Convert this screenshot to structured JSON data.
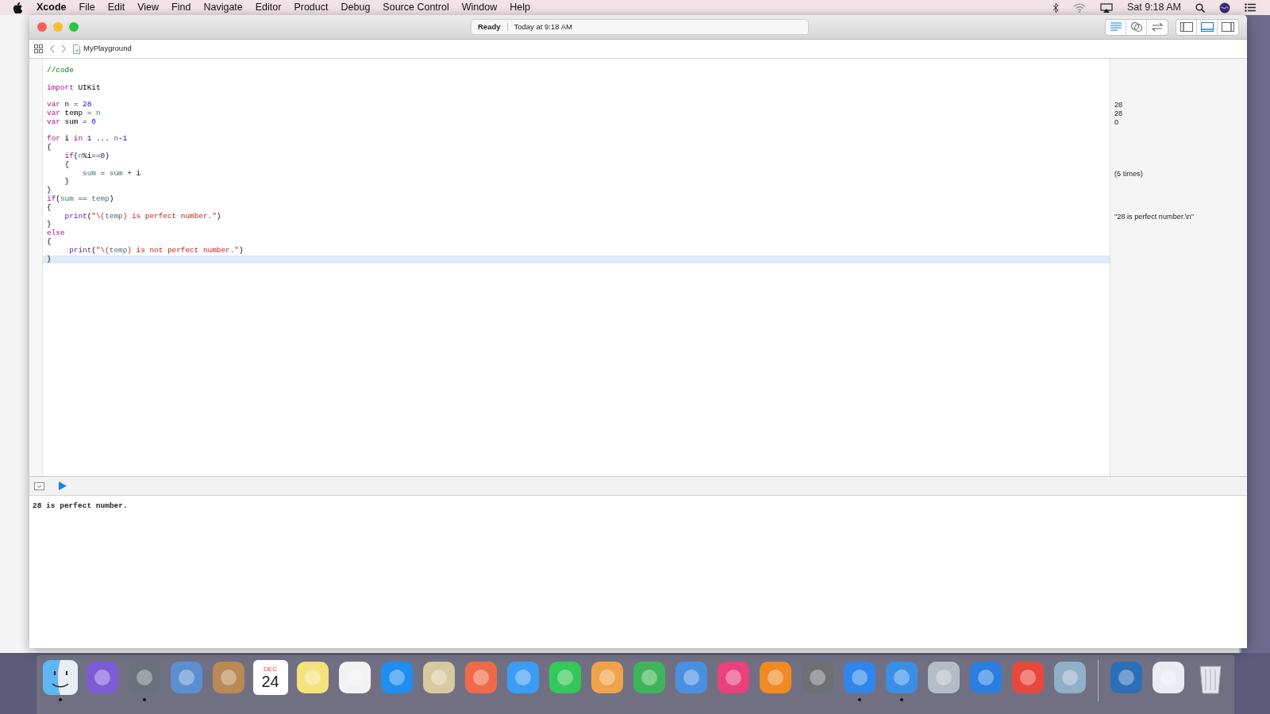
{
  "menu_bar": {
    "app_name": "Xcode",
    "menus": [
      "File",
      "Edit",
      "View",
      "Find",
      "Navigate",
      "Editor",
      "Product",
      "Debug",
      "Source Control",
      "Window",
      "Help"
    ],
    "clock": "Sat 9:18 AM"
  },
  "window": {
    "activity": {
      "status": "Ready",
      "time": "Today at 9:18 AM"
    },
    "editor_modes": [
      {
        "kind": "standard",
        "selected": true
      },
      {
        "kind": "assistant",
        "selected": false
      },
      {
        "kind": "version",
        "selected": false
      }
    ],
    "panels": [
      {
        "kind": "navigator",
        "selected": false
      },
      {
        "kind": "debug",
        "selected": true
      },
      {
        "kind": "utilities",
        "selected": false
      }
    ],
    "file_name": "MyPlayground"
  },
  "code_lines": [
    {
      "kind": "code",
      "current": false,
      "tokens": [
        {
          "text": "//code",
          "kind": "comment"
        }
      ]
    },
    {
      "kind": "blank"
    },
    {
      "kind": "code",
      "current": false,
      "tokens": [
        {
          "text": "import",
          "kind": "keyword"
        },
        {
          "text": " UIKit",
          "kind": "plain"
        }
      ]
    },
    {
      "kind": "blank"
    },
    {
      "kind": "code",
      "current": false,
      "result": "28",
      "tokens": [
        {
          "text": "var",
          "kind": "keyword"
        },
        {
          "text": " n = ",
          "kind": "plain"
        },
        {
          "text": "28",
          "kind": "number"
        }
      ]
    },
    {
      "kind": "code",
      "current": false,
      "result": "28",
      "tokens": [
        {
          "text": "var",
          "kind": "keyword"
        },
        {
          "text": " temp = ",
          "kind": "plain"
        },
        {
          "text": "n",
          "kind": "ident"
        }
      ]
    },
    {
      "kind": "code",
      "current": false,
      "result": "0",
      "tokens": [
        {
          "text": "var",
          "kind": "keyword"
        },
        {
          "text": " sum = ",
          "kind": "plain"
        },
        {
          "text": "0",
          "kind": "number"
        }
      ]
    },
    {
      "kind": "blank"
    },
    {
      "kind": "code",
      "current": false,
      "tokens": [
        {
          "text": "for",
          "kind": "keyword"
        },
        {
          "text": " i ",
          "kind": "plain"
        },
        {
          "text": "in",
          "kind": "keyword"
        },
        {
          "text": " 1",
          "kind": "number"
        },
        {
          "text": " ... ",
          "kind": "plain"
        },
        {
          "text": "n",
          "kind": "ident"
        },
        {
          "text": "-",
          "kind": "plain"
        },
        {
          "text": "1",
          "kind": "number"
        }
      ]
    },
    {
      "kind": "code",
      "current": false,
      "tokens": [
        {
          "text": "{",
          "kind": "plain"
        }
      ]
    },
    {
      "kind": "code",
      "current": false,
      "tokens": [
        {
          "text": "    if",
          "kind": "keyword"
        },
        {
          "text": "(",
          "kind": "plain"
        },
        {
          "text": "n",
          "kind": "ident"
        },
        {
          "text": "%i==",
          "kind": "plain"
        },
        {
          "text": "0",
          "kind": "number"
        },
        {
          "text": ")",
          "kind": "plain"
        }
      ]
    },
    {
      "kind": "code",
      "current": false,
      "tokens": [
        {
          "text": "    {",
          "kind": "plain"
        }
      ]
    },
    {
      "kind": "code",
      "current": false,
      "result": "(5 times)",
      "tokens": [
        {
          "text": "        sum",
          "kind": "ident"
        },
        {
          "text": " = ",
          "kind": "plain"
        },
        {
          "text": "sum",
          "kind": "ident"
        },
        {
          "text": " + i",
          "kind": "plain"
        }
      ]
    },
    {
      "kind": "code",
      "current": false,
      "tokens": [
        {
          "text": "    }",
          "kind": "plain"
        }
      ]
    },
    {
      "kind": "code",
      "current": false,
      "tokens": [
        {
          "text": "}",
          "kind": "plain"
        }
      ]
    },
    {
      "kind": "code",
      "current": false,
      "tokens": [
        {
          "text": "if",
          "kind": "keyword"
        },
        {
          "text": "(",
          "kind": "plain"
        },
        {
          "text": "sum",
          "kind": "ident"
        },
        {
          "text": " == ",
          "kind": "plain"
        },
        {
          "text": "temp",
          "kind": "ident"
        },
        {
          "text": ")",
          "kind": "plain"
        }
      ]
    },
    {
      "kind": "code",
      "current": false,
      "tokens": [
        {
          "text": "{",
          "kind": "plain"
        }
      ]
    },
    {
      "kind": "code",
      "current": false,
      "result": "\"28 is perfect number.\\n\"",
      "tokens": [
        {
          "text": "    print",
          "kind": "func"
        },
        {
          "text": "(",
          "kind": "plain"
        },
        {
          "text": "\"\\(",
          "kind": "string"
        },
        {
          "text": "temp",
          "kind": "ident"
        },
        {
          "text": ") is perfect number.\"",
          "kind": "string"
        },
        {
          "text": ")",
          "kind": "plain"
        }
      ]
    },
    {
      "kind": "code",
      "current": false,
      "tokens": [
        {
          "text": "}",
          "kind": "plain"
        }
      ]
    },
    {
      "kind": "code",
      "current": false,
      "tokens": [
        {
          "text": "else",
          "kind": "keyword"
        }
      ]
    },
    {
      "kind": "code",
      "current": false,
      "tokens": [
        {
          "text": "{",
          "kind": "plain"
        }
      ]
    },
    {
      "kind": "code",
      "current": false,
      "tokens": [
        {
          "text": "     print",
          "kind": "func"
        },
        {
          "text": "(",
          "kind": "plain"
        },
        {
          "text": "\"\\(",
          "kind": "string"
        },
        {
          "text": "temp",
          "kind": "ident"
        },
        {
          "text": ") is not perfect number.\"",
          "kind": "string"
        },
        {
          "text": ")",
          "kind": "plain"
        }
      ]
    },
    {
      "kind": "code",
      "current": true,
      "tokens": [
        {
          "text": "}",
          "kind": "plain"
        }
      ]
    }
  ],
  "console": {
    "output": "28 is perfect number."
  },
  "dock": [
    {
      "kind": "finder",
      "running": true
    },
    {
      "kind": "app",
      "color": "#7b5cd6",
      "running": false
    },
    {
      "kind": "app",
      "color": "#6b707a",
      "running": true
    },
    {
      "kind": "app",
      "color": "#5a8fd0",
      "running": false
    },
    {
      "kind": "app",
      "color": "#b98a55",
      "running": false
    },
    {
      "kind": "calendar",
      "month": "DEC",
      "day": "24",
      "running": false
    },
    {
      "kind": "app",
      "color": "#f5e27a",
      "running": false
    },
    {
      "kind": "app",
      "color": "#f2f2f2",
      "running": false
    },
    {
      "kind": "app",
      "color": "#1e8ef0",
      "running": false
    },
    {
      "kind": "app",
      "color": "#d8c9a0",
      "running": false
    },
    {
      "kind": "app",
      "color": "#f06a4a",
      "running": false
    },
    {
      "kind": "app",
      "color": "#3b9cf5",
      "running": false
    },
    {
      "kind": "app",
      "color": "#34c759",
      "running": false
    },
    {
      "kind": "app",
      "color": "#f0a34a",
      "running": false
    },
    {
      "kind": "app",
      "color": "#3fb45a",
      "running": false
    },
    {
      "kind": "app",
      "color": "#4a90e2",
      "running": false
    },
    {
      "kind": "app",
      "color": "#e9417b",
      "running": false
    },
    {
      "kind": "app",
      "color": "#f08a24",
      "running": false
    },
    {
      "kind": "app",
      "color": "#6d6f73",
      "running": false
    },
    {
      "kind": "app",
      "color": "#2f86eb",
      "running": true
    },
    {
      "kind": "app",
      "color": "#3a8ee6",
      "running": true
    },
    {
      "kind": "app",
      "color": "#b4bcc6",
      "running": false
    },
    {
      "kind": "app",
      "color": "#2a7de1",
      "running": false
    },
    {
      "kind": "app",
      "color": "#e8473b",
      "running": false
    },
    {
      "kind": "app",
      "color": "#8fb0c8",
      "running": false
    },
    {
      "kind": "divider"
    },
    {
      "kind": "app",
      "color": "#2b6fb8",
      "running": false
    },
    {
      "kind": "app",
      "color": "#e9edf2",
      "running": false
    },
    {
      "kind": "trash",
      "running": false
    }
  ]
}
